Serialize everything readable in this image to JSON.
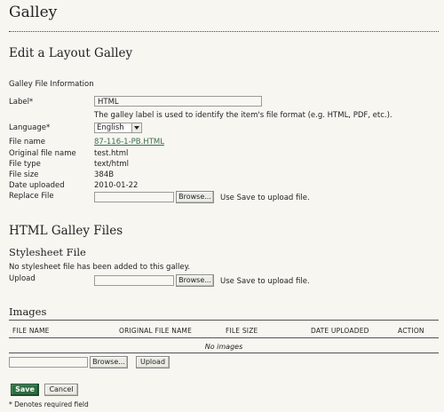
{
  "page": {
    "title": "Galley"
  },
  "edit": {
    "heading": "Edit a Layout Galley",
    "section_label": "Galley File Information",
    "label_label": "Label*",
    "label_value": "HTML",
    "label_help": "The galley label is used to identify the item's file format (e.g. HTML, PDF, etc.).",
    "language_label": "Language*",
    "language_value": "English",
    "file_name_label": "File name",
    "file_name_value": "87-116-1-PB.HTML",
    "original_file_name_label": "Original file name",
    "original_file_name_value": "test.html",
    "file_type_label": "File type",
    "file_type_value": "text/html",
    "file_size_label": "File size",
    "file_size_value": "384B",
    "date_uploaded_label": "Date uploaded",
    "date_uploaded_value": "2010-01-22",
    "replace_file_label": "Replace File",
    "browse_label": "Browse...",
    "replace_hint": "Use Save to upload file."
  },
  "html_galley": {
    "heading": "HTML Galley Files",
    "stylesheet_heading": "Stylesheet File",
    "stylesheet_note": "No stylesheet file has been added to this galley.",
    "upload_label": "Upload",
    "browse_label": "Browse...",
    "upload_hint": "Use Save to upload file."
  },
  "images": {
    "heading": "Images",
    "columns": [
      "FILE NAME",
      "ORIGINAL FILE NAME",
      "FILE SIZE",
      "DATE UPLOADED",
      "ACTION"
    ],
    "empty_text": "No images",
    "browse_label": "Browse...",
    "upload_label": "Upload"
  },
  "actions": {
    "save_label": "Save",
    "cancel_label": "Cancel"
  },
  "footer": {
    "required_note": "* Denotes required field"
  }
}
